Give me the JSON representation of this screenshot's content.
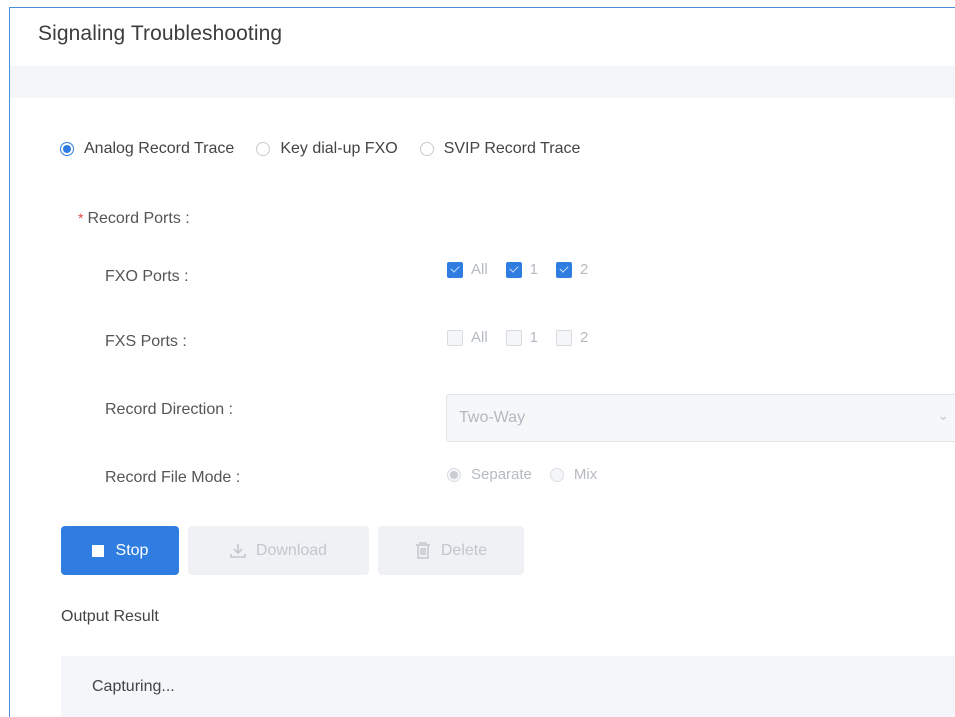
{
  "page_title": "Signaling Troubleshooting",
  "trace_types": [
    {
      "label": "Analog Record Trace",
      "selected": true
    },
    {
      "label": "Key dial-up FXO",
      "selected": false
    },
    {
      "label": "SVIP Record Trace",
      "selected": false
    }
  ],
  "record_ports_label": "Record Ports :",
  "required_mark": "*",
  "fxo_ports": {
    "label": "FXO Ports :",
    "options": [
      {
        "label": "All",
        "checked": true
      },
      {
        "label": "1",
        "checked": true
      },
      {
        "label": "2",
        "checked": true
      }
    ]
  },
  "fxs_ports": {
    "label": "FXS Ports :",
    "options": [
      {
        "label": "All",
        "checked": false
      },
      {
        "label": "1",
        "checked": false
      },
      {
        "label": "2",
        "checked": false
      }
    ]
  },
  "record_direction": {
    "label": "Record Direction :",
    "value": "Two-Way"
  },
  "record_file_mode": {
    "label": "Record File Mode :",
    "options": [
      {
        "label": "Separate",
        "selected": true
      },
      {
        "label": "Mix",
        "selected": false
      }
    ]
  },
  "buttons": {
    "stop": "Stop",
    "download": "Download",
    "delete": "Delete"
  },
  "output": {
    "title": "Output Result",
    "text": "Capturing..."
  },
  "colors": {
    "accent": "#2f7de1",
    "required": "#e54848",
    "frame_border": "#4a90d9"
  }
}
